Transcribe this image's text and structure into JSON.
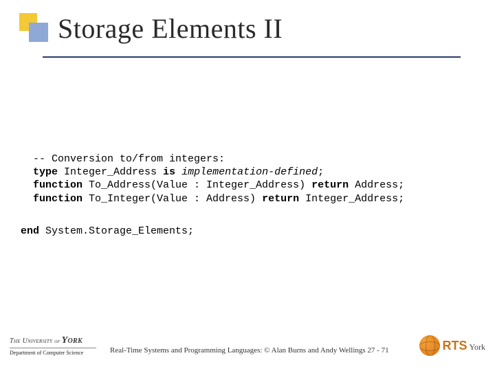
{
  "title": "Storage Elements II",
  "code": {
    "comment": "-- Conversion to/from integers:",
    "type_kw": "type",
    "type_name": " Integer_Address ",
    "is_kw": "is",
    "impl_def": " implementation-defined",
    "semi": ";",
    "func_kw": "function",
    "to_addr": " To_Address(Value : Integer_Address) ",
    "return_kw": "return",
    "addr_tail": " Address;",
    "to_int": " To_Integer(Value : Address) ",
    "intaddr_tail": " Integer_Address;"
  },
  "end_line": {
    "end_kw": "end",
    "rest": " System.Storage_Elements;"
  },
  "footer": {
    "uni_line1_a": "The University ",
    "uni_line1_of": "of",
    "uni_york": "York",
    "uni_dept": "Department of Computer Science",
    "credit": "Real-Time Systems and Programming Languages: © Alan Burns and Andy Wellings 27 - 71",
    "rts": "RTS",
    "rts_york": "York"
  }
}
